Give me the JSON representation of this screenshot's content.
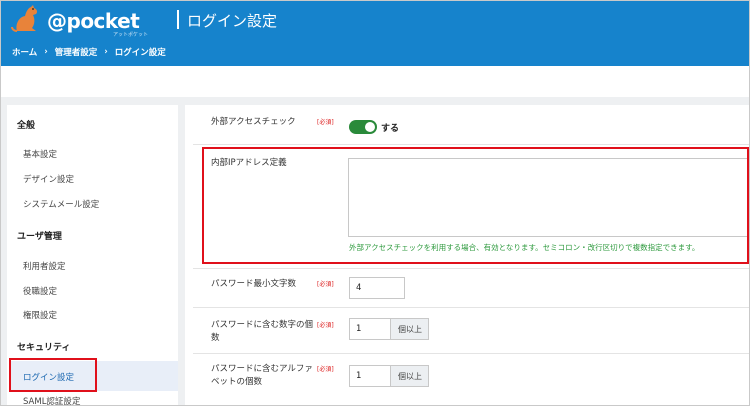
{
  "header": {
    "brand": "@pocket",
    "brand_sub": "アットポケット",
    "title": "ログイン設定",
    "breadcrumb": [
      "ホーム",
      "管理者設定",
      "ログイン設定"
    ],
    "breadcrumb_sep": "›"
  },
  "sidebar": {
    "sections": [
      {
        "heading": "全般",
        "items": [
          "基本設定",
          "デザイン設定",
          "システムメール設定"
        ]
      },
      {
        "heading": "ユーザ管理",
        "items": [
          "利用者設定",
          "役職設定",
          "権限設定"
        ]
      },
      {
        "heading": "セキュリティ",
        "items": [
          "ログイン設定",
          "SAML認証設定"
        ]
      }
    ],
    "active_item": "ログイン設定"
  },
  "form": {
    "external_access": {
      "label": "外部アクセスチェック",
      "required": "[必須]",
      "toggle_label": "する",
      "toggle_on": true
    },
    "internal_ip": {
      "label": "内部IPアドレス定義",
      "value": "",
      "help": "外部アクセスチェックを利用する場合、有効となります。セミコロン・改行区切りで複数指定できます。"
    },
    "password_min": {
      "label": "パスワード最小文字数",
      "required": "[必須]",
      "value": "4"
    },
    "password_digits": {
      "label_line1": "パスワードに含む数字の個",
      "label_line2": "数",
      "required": "[必須]",
      "value": "1",
      "unit": "個以上"
    },
    "password_alpha": {
      "label_line1": "パスワードに含むアルファ",
      "label_line2": "ベットの個数",
      "required": "[必須]",
      "value": "1",
      "unit": "個以上"
    }
  },
  "colors": {
    "header": "#1683cc",
    "highlight": "#e0101b",
    "toggle": "#2a8a3a",
    "help_text": "#2e9a3e"
  }
}
